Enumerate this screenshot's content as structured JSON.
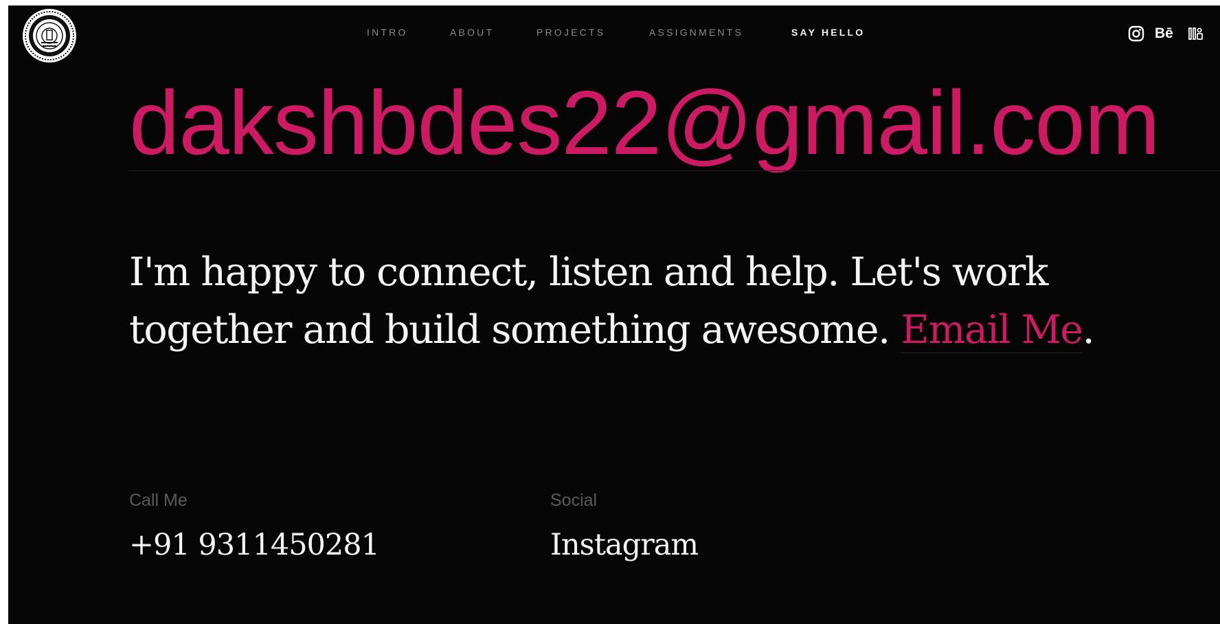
{
  "header": {
    "logo_icon": "university-seal-icon",
    "nav": {
      "intro": "INTRO",
      "about": "ABOUT",
      "projects": "PROJECTS",
      "assignments": "ASSIGNMENTS",
      "say_hello": "SAY HELLO"
    },
    "active_nav": "SAY HELLO",
    "socials": {
      "instagram_icon": "instagram-icon",
      "behance_label": "Bē",
      "behance_icon": "behance-icon",
      "issuu_icon": "issuu-icon"
    }
  },
  "hero": {
    "email": "dakshbdes22@gmail.com"
  },
  "tagline": {
    "text": "I'm happy to connect, listen and help. Let's work together and build something awesome. ",
    "link_label": "Email Me",
    "end_punctuation": "."
  },
  "contact": {
    "call_label": "Call Me",
    "phone": "+91 9311450281",
    "social_label": "Social",
    "social_link": "Instagram"
  },
  "colors": {
    "background": "#060606",
    "accent": "#cc1a63",
    "text": "#f4f4f4",
    "muted": "#5a5a5a"
  }
}
